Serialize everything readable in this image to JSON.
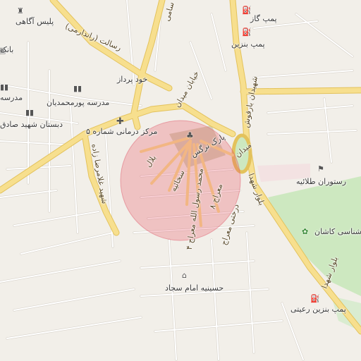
{
  "map": {
    "colors": {
      "background": "#f2efe9",
      "major_road": "#f6dd8c",
      "major_road_casing": "#e2c15a",
      "minor_road": "#ffffff",
      "minor_road_casing": "#d5d0c8",
      "park": "#cde8c0",
      "highlight_circle": "#f0a0a8",
      "square": "#c8c2a8",
      "industrial": "#f0dcdc"
    },
    "highlight": {
      "shape": "circle",
      "fill": "#e85a6a",
      "opacity": 0.35
    },
    "pois": [
      {
        "id": "police",
        "label": "پلیس آگاهی",
        "icon": "police-icon"
      },
      {
        "id": "bank",
        "label": "بانک",
        "icon": "bank-icon"
      },
      {
        "id": "school1",
        "label": "مدرسه",
        "icon": "school-icon"
      },
      {
        "id": "school2",
        "label": "مدرسه پورمحمدیان",
        "icon": "school-icon"
      },
      {
        "id": "school3",
        "label": "دبستان شهید صادق",
        "icon": "school-icon"
      },
      {
        "id": "clinic",
        "label": "مرکز درمانی شماره ۵",
        "icon": "cross-icon"
      },
      {
        "id": "carwash",
        "label": "خود پرداز",
        "icon": "atm-icon"
      },
      {
        "id": "park",
        "label": "پارک نرگس",
        "icon": "tree-icon"
      },
      {
        "id": "gas1",
        "label": "پمپ گاز",
        "icon": "fuel-icon"
      },
      {
        "id": "gas2",
        "label": "پمپ بنزین",
        "icon": "fuel-icon"
      },
      {
        "id": "restaurant",
        "label": "رستوران طلائیه",
        "icon": "restaurant-icon"
      },
      {
        "id": "kashan",
        "label": "شناسی کاشان",
        "icon": "lotus-icon"
      },
      {
        "id": "hosseinieh",
        "label": "حسینیه امام سجاد",
        "icon": "mosque-icon"
      },
      {
        "id": "gas3",
        "label": "پمپ بنزین رعیتی",
        "icon": "fuel-icon"
      }
    ],
    "roads": [
      {
        "id": "resalat",
        "label": "رسالت (راندارمی)"
      },
      {
        "id": "meydan",
        "label": "خیابان میدان"
      },
      {
        "id": "shohada_top",
        "label": "شهیدان بارقوش"
      },
      {
        "id": "qolamreza",
        "label": "شهید غلامرضا زاده"
      },
      {
        "id": "belal",
        "label": "بلال"
      },
      {
        "id": "sakhtamani",
        "label": "سخائیه"
      },
      {
        "id": "mohammad",
        "label": "محمد رسول الله معراج ۴"
      },
      {
        "id": "meraj",
        "label": "معراج ۸"
      },
      {
        "id": "derakhti",
        "label": "درختی معراج"
      },
      {
        "id": "bolvar1",
        "label": "بلوار شهدا"
      },
      {
        "id": "bolvar2",
        "label": "بلوار شهدا"
      },
      {
        "id": "meydan2",
        "label": "میدان"
      },
      {
        "id": "sami",
        "label": "سامی"
      }
    ]
  }
}
